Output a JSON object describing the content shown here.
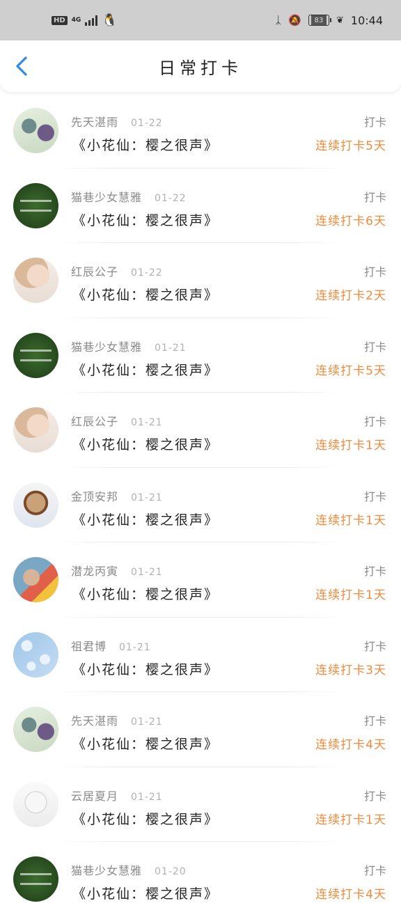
{
  "status_bar": {
    "hd": "HD",
    "network": "4G",
    "battery": "83",
    "time": "10:44"
  },
  "header": {
    "title": "日常打卡"
  },
  "colors": {
    "accent": "#2f8be8",
    "streak": "#f08a3c",
    "muted": "#8a8a8a"
  },
  "entries": [
    {
      "name": "先天湛雨",
      "date": "01-22",
      "book": "《小花仙：樱之很声》",
      "action": "打卡",
      "streak": "连续打卡5天"
    },
    {
      "name": "猫巷少女慧雅",
      "date": "01-22",
      "book": "《小花仙：樱之很声》",
      "action": "打卡",
      "streak": "连续打卡6天"
    },
    {
      "name": "红辰公子",
      "date": "01-22",
      "book": "《小花仙：樱之很声》",
      "action": "打卡",
      "streak": "连续打卡2天"
    },
    {
      "name": "猫巷少女慧雅",
      "date": "01-21",
      "book": "《小花仙：樱之很声》",
      "action": "打卡",
      "streak": "连续打卡5天"
    },
    {
      "name": "红辰公子",
      "date": "01-21",
      "book": "《小花仙：樱之很声》",
      "action": "打卡",
      "streak": "连续打卡1天"
    },
    {
      "name": "金顶安邦",
      "date": "01-21",
      "book": "《小花仙：樱之很声》",
      "action": "打卡",
      "streak": "连续打卡1天"
    },
    {
      "name": "潜龙丙寅",
      "date": "01-21",
      "book": "《小花仙：樱之很声》",
      "action": "打卡",
      "streak": "连续打卡1天"
    },
    {
      "name": "祖君博",
      "date": "01-21",
      "book": "《小花仙：樱之很声》",
      "action": "打卡",
      "streak": "连续打卡3天"
    },
    {
      "name": "先天湛雨",
      "date": "01-21",
      "book": "《小花仙：樱之很声》",
      "action": "打卡",
      "streak": "连续打卡4天"
    },
    {
      "name": "云居夏月",
      "date": "01-21",
      "book": "《小花仙：樱之很声》",
      "action": "打卡",
      "streak": "连续打卡1天"
    },
    {
      "name": "猫巷少女慧雅",
      "date": "01-20",
      "book": "《小花仙：樱之很声》",
      "action": "打卡",
      "streak": "连续打卡4天"
    }
  ]
}
